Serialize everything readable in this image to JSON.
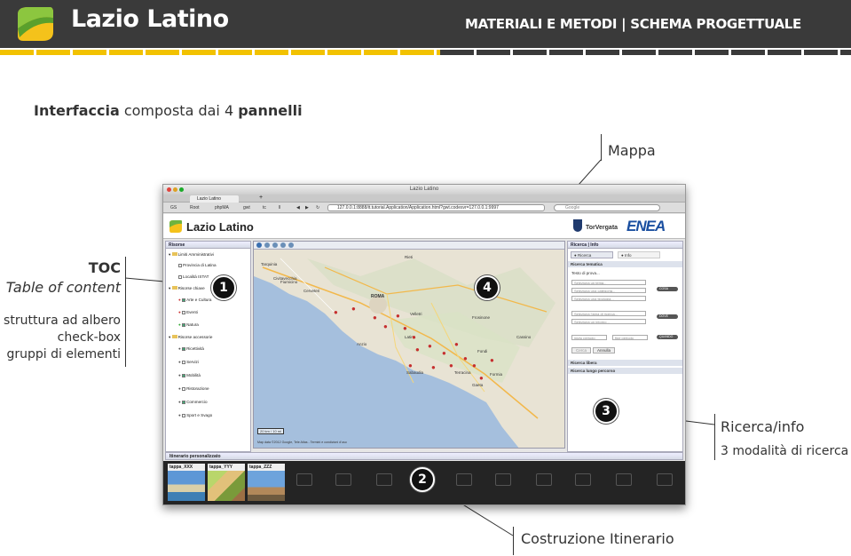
{
  "header": {
    "title": "Lazio Latino",
    "subtitle": "MATERIALI E METODI | SCHEMA PROGETTUALE"
  },
  "intro": {
    "part1": "Interfaccia",
    "part2": " composta dai 4 ",
    "part3": "pannelli"
  },
  "annotations": {
    "mappa": "Mappa",
    "toc_title": "TOC",
    "toc_subtitle": "Table of content",
    "toc_lines": [
      "struttura ad albero",
      "check-box",
      "gruppi di elementi"
    ],
    "ricerca_title": "Ricerca/info",
    "ricerca_sub": "3 modalità di ricerca",
    "itinerario": "Costruzione Itinerario"
  },
  "badges": [
    "1",
    "2",
    "3",
    "4"
  ],
  "browser": {
    "window_title": "Lazio Latino",
    "tab_label": "Lazio Latino",
    "bookmarks": [
      "GS",
      "Root",
      "phpMA",
      "gwt",
      "tc",
      "ll"
    ],
    "url": "127.0.0.1:8888/it.tutorial.Application/Application.html?gwt.codesvr=127.0.0.1:9997",
    "search_placeholder": "Google"
  },
  "app": {
    "title": "Lazio Latino",
    "sponsor_tor": "TorVergata",
    "sponsor_enea": "ENEA"
  },
  "toc": {
    "header": "Risorse",
    "items": [
      "Limiti Amministrativi",
      "Provincia di Latina",
      "Località ISTAT",
      "Risorse chiave",
      "Arte e Cultura",
      "Eventi",
      "Natura",
      "Risorse accessorie",
      "Ricettività",
      "Servizi",
      "Mobilità",
      "Ristorazione",
      "Commercio",
      "Sport e Svago"
    ]
  },
  "map": {
    "places": [
      "Tarquinia",
      "Civitavecchia",
      "Cerveteri",
      "Fiumicino",
      "ROMA",
      "Anzio",
      "Latina",
      "Sabaudia",
      "Terracina",
      "Gaeta",
      "Formia",
      "Frosinone",
      "Rieti",
      "Cassino",
      "Velletri",
      "Fondi"
    ],
    "copyright": "Map data ©2012 Google, Tele Atlas - Termini e condizioni d'uso",
    "scale": "20 km / 10 mi"
  },
  "right_panel": {
    "header": "Ricerca | Info",
    "tab_search": "Ricerca",
    "tab_info": "Info",
    "section_thematic": "Ricerca tematica",
    "search_text_label": "Testo di prova...",
    "select_theme": "Seleziona un tema...",
    "select_category": "Seleziona una categoria...",
    "select_type": "Seleziona una tipologia...",
    "select_area": "Seleziona l'area di ricerca...",
    "select_around": "Seleziona un intorno...",
    "start_period": "inizio periodo",
    "end_period": "fine periodo",
    "toggle_cosa": "COSA",
    "toggle_dove": "DOVE",
    "toggle_quando": "QUANDO",
    "btn_search": "Cerca",
    "btn_cancel": "Annulla",
    "section_free": "Ricerca libera",
    "section_route": "Ricerca lungo percorso"
  },
  "itinerary": {
    "header": "Itinerario personalizzato",
    "stops": [
      "tappa_XXX",
      "tappa_YYY",
      "tappa_ZZZ"
    ]
  }
}
